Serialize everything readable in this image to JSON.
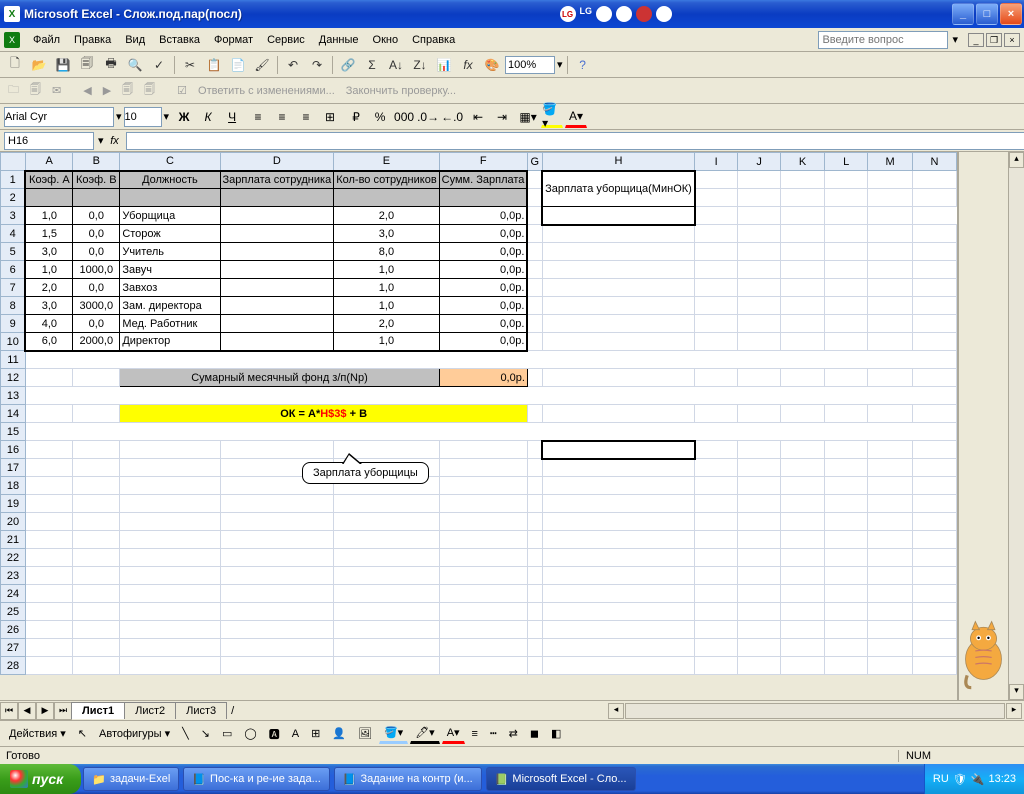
{
  "title": "Microsoft Excel - Слож.под.пар(посл)",
  "menus": [
    "Файл",
    "Правка",
    "Вид",
    "Вставка",
    "Формат",
    "Сервис",
    "Данные",
    "Окно",
    "Справка"
  ],
  "ask_placeholder": "Введите вопрос",
  "review": {
    "reply": "Ответить с изменениями...",
    "end": "Закончить проверку..."
  },
  "zoom": "100%",
  "font_name": "Arial Cyr",
  "font_size": "10",
  "namebox": "H16",
  "formula": "",
  "columns": [
    "A",
    "B",
    "C",
    "D",
    "E",
    "F",
    "G",
    "H",
    "I",
    "J",
    "K",
    "L",
    "M",
    "N"
  ],
  "headers": {
    "A": "Коэф. А",
    "B": "Коэф. В",
    "C": "Должность",
    "D": "Зарплата сотрудника",
    "E": "Кол-во сотрудников",
    "F": "Сумм. Зарплата"
  },
  "sidehdr": "Зарплата уборщица(МинОК)",
  "rows": [
    {
      "A": "1,0",
      "B": "0,0",
      "C": "Уборщица",
      "E": "2,0",
      "F": "0,0р."
    },
    {
      "A": "1,5",
      "B": "0,0",
      "C": "Сторож",
      "E": "3,0",
      "F": "0,0р."
    },
    {
      "A": "3,0",
      "B": "0,0",
      "C": "Учитель",
      "E": "8,0",
      "F": "0,0р."
    },
    {
      "A": "1,0",
      "B": "1000,0",
      "C": "Завуч",
      "E": "1,0",
      "F": "0,0р."
    },
    {
      "A": "2,0",
      "B": "0,0",
      "C": "Завхоз",
      "E": "1,0",
      "F": "0,0р."
    },
    {
      "A": "3,0",
      "B": "3000,0",
      "C": "Зам. директора",
      "E": "1,0",
      "F": "0,0р."
    },
    {
      "A": "4,0",
      "B": "0,0",
      "C": "Мед. Работник",
      "E": "2,0",
      "F": "0,0р."
    },
    {
      "A": "6,0",
      "B": "2000,0",
      "C": "Директор",
      "E": "1,0",
      "F": "0,0р."
    }
  ],
  "sum_label": "Сумарный месячный фонд з/п(Np)",
  "sum_val": "0,0р.",
  "formula_row": {
    "pre": "ОК = А*",
    "ref": "H$3$",
    "post": " + В"
  },
  "callout": "Зарплата уборщицы",
  "sheets": [
    "Лист1",
    "Лист2",
    "Лист3"
  ],
  "draw": {
    "actions": "Действия",
    "autoshapes": "Автофигуры"
  },
  "status": {
    "ready": "Готово",
    "num": "NUM"
  },
  "taskbar": {
    "start": "пуск",
    "items": [
      "задачи-Exel",
      "Пос-ка и ре-ие зада...",
      "Задание на контр (и...",
      "Microsoft Excel - Сло..."
    ],
    "lang": "RU",
    "time": "13:23"
  }
}
